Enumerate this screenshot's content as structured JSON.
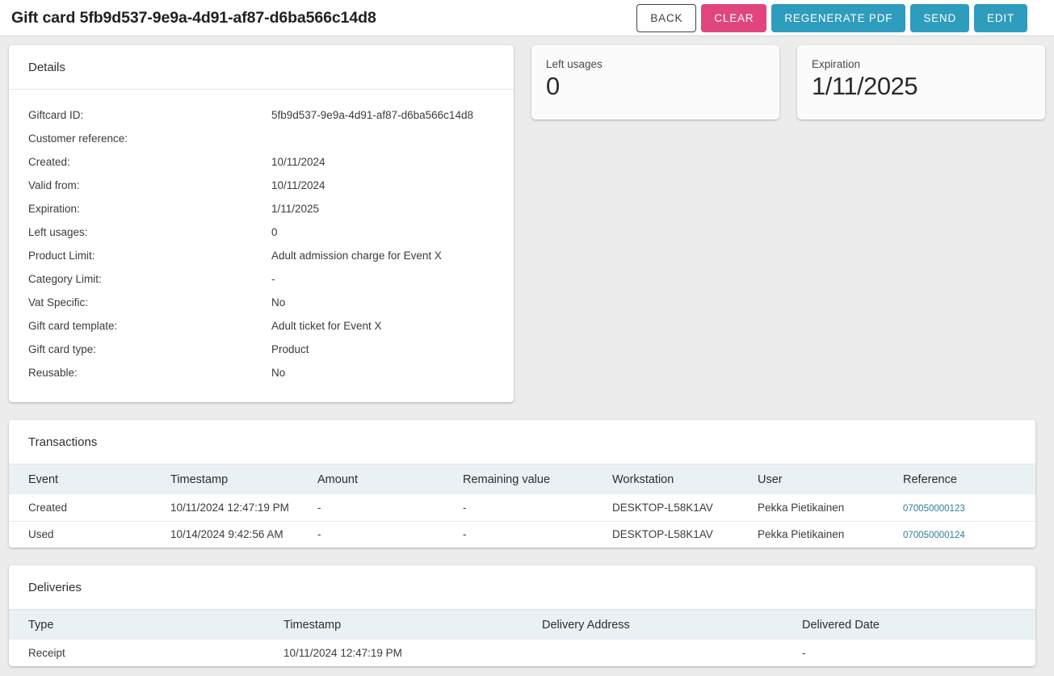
{
  "header": {
    "title": "Gift card 5fb9d537-9e9a-4d91-af87-d6ba566c14d8",
    "buttons": [
      {
        "label": "BACK",
        "style": "outline"
      },
      {
        "label": "CLEAR",
        "style": "pink"
      },
      {
        "label": "REGENERATE PDF",
        "style": "teal"
      },
      {
        "label": "SEND",
        "style": "teal"
      },
      {
        "label": "EDIT",
        "style": "teal"
      }
    ]
  },
  "colors": {
    "page_background": "#ececec",
    "accent_teal": "#2e9cbd",
    "accent_pink": "#e0457d",
    "table_header": "#eaf1f4",
    "link": "#2a7f9e"
  },
  "details": {
    "title": "Details",
    "rows": [
      {
        "label": "Giftcard ID:",
        "value": "5fb9d537-9e9a-4d91-af87-d6ba566c14d8"
      },
      {
        "label": "Customer reference:",
        "value": ""
      },
      {
        "label": "Created:",
        "value": "10/11/2024"
      },
      {
        "label": "Valid from:",
        "value": "10/11/2024"
      },
      {
        "label": "Expiration:",
        "value": "1/11/2025"
      },
      {
        "label": "Left usages:",
        "value": "0"
      },
      {
        "label": "Product Limit:",
        "value": "Adult admission charge for Event X"
      },
      {
        "label": "Category Limit:",
        "value": "-"
      },
      {
        "label": "Vat Specific:",
        "value": "No"
      },
      {
        "label": "Gift card template:",
        "value": "Adult ticket for Event X"
      },
      {
        "label": "Gift card type:",
        "value": "Product"
      },
      {
        "label": "Reusable:",
        "value": "No"
      }
    ]
  },
  "stats": [
    {
      "label": "Left usages",
      "value": "0"
    },
    {
      "label": "Expiration",
      "value": "1/11/2025"
    }
  ],
  "transactions": {
    "title": "Transactions",
    "columns": [
      "Event",
      "Timestamp",
      "Amount",
      "Remaining value",
      "Workstation",
      "User",
      "Reference"
    ],
    "rows": [
      {
        "event": "Created",
        "timestamp": "10/11/2024 12:47:19 PM",
        "amount": "-",
        "remaining_value": "-",
        "workstation": "DESKTOP-L58K1AV",
        "user": "Pekka Pietikainen",
        "reference": "070050000123"
      },
      {
        "event": "Used",
        "timestamp": "10/14/2024 9:42:56 AM",
        "amount": "-",
        "remaining_value": "-",
        "workstation": "DESKTOP-L58K1AV",
        "user": "Pekka Pietikainen",
        "reference": "070050000124"
      }
    ]
  },
  "deliveries": {
    "title": "Deliveries",
    "columns": [
      "Type",
      "Timestamp",
      "Delivery Address",
      "Delivered Date"
    ],
    "rows": [
      {
        "type": "Receipt",
        "timestamp": "10/11/2024 12:47:19 PM",
        "delivery_address": "",
        "delivered_date": "-"
      }
    ]
  }
}
